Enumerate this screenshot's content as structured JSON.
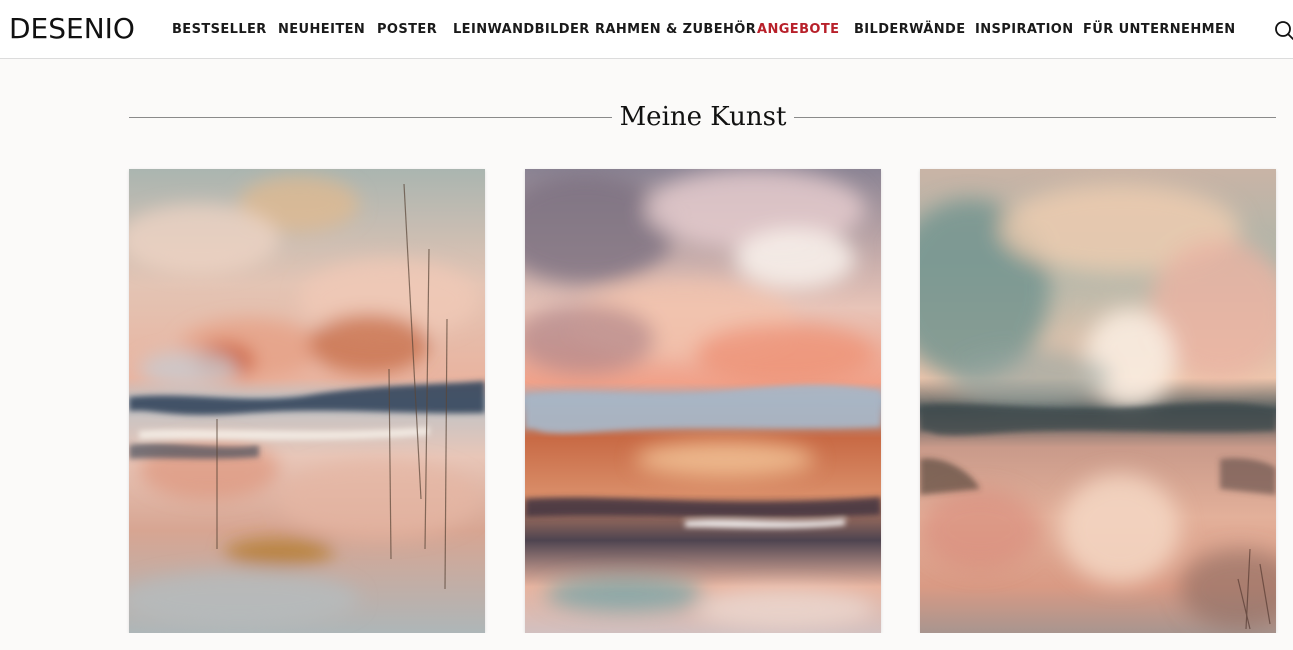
{
  "brand": {
    "logo_text": "DESENIO"
  },
  "nav": {
    "items": [
      {
        "label": "BESTSELLER"
      },
      {
        "label": "NEUHEITEN"
      },
      {
        "label": "POSTER"
      },
      {
        "label": "LEINWANDBILDER"
      },
      {
        "label": "RAHMEN & ZUBEHÖR"
      },
      {
        "label": "ANGEBOTE",
        "highlight": "#b8202a"
      },
      {
        "label": "BILDERWÄNDE"
      },
      {
        "label": "INSPIRATION"
      },
      {
        "label": "FÜR UNTERNEHMEN"
      }
    ],
    "search_icon": "search-icon"
  },
  "section": {
    "title": "Meine Kunst"
  },
  "artworks": [
    {
      "name": "abstract-landscape-reeds",
      "palette": [
        "#a9b4b2",
        "#e9c2b4",
        "#c8623e",
        "#37485a",
        "#d7a08c"
      ]
    },
    {
      "name": "abstract-landscape-clouds",
      "palette": [
        "#8c7f8e",
        "#f1c6b5",
        "#eb8c73",
        "#9aa8b8",
        "#c9603b"
      ]
    },
    {
      "name": "abstract-landscape-teal-sky",
      "palette": [
        "#7f9a96",
        "#f0c7a8",
        "#e8a088",
        "#3d4a4e",
        "#e7b39a"
      ]
    }
  ]
}
